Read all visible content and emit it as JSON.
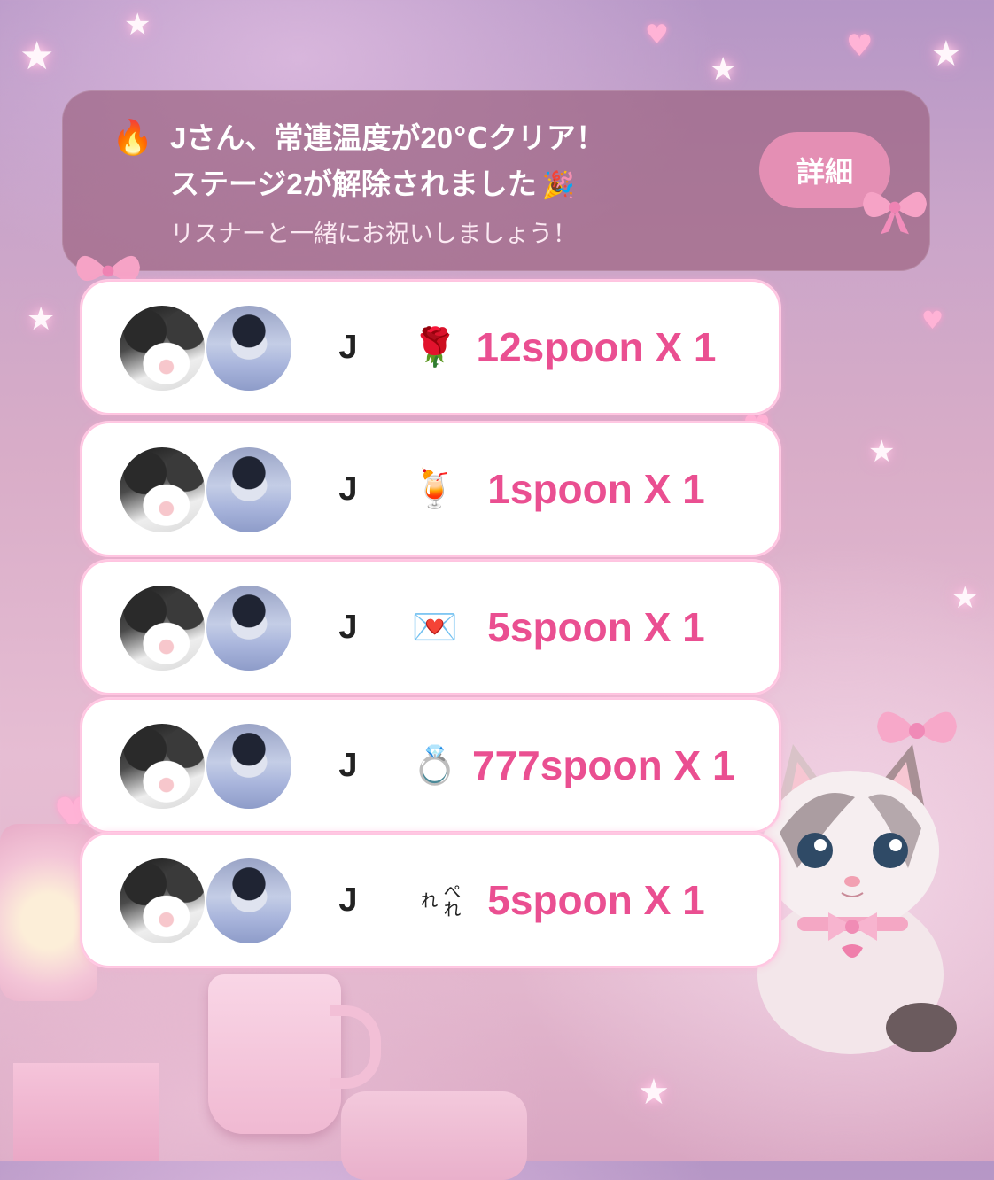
{
  "banner": {
    "icon": "🔥",
    "line1": "Jさん、常連温度が20℃クリア！",
    "line2": "ステージ2が解除されました",
    "line2_icon": "🎉",
    "line3": "リスナーと一緒にお祝いしましょう！",
    "detail_button": "詳細"
  },
  "gifts": [
    {
      "user": "J",
      "gift_icon": "🌹",
      "amount": "12spoon X 1"
    },
    {
      "user": "J",
      "gift_icon": "🍹",
      "amount": "1spoon X 1"
    },
    {
      "user": "J",
      "gift_icon": "💌",
      "amount": "5spoon X 1"
    },
    {
      "user": "J",
      "gift_icon": "💍",
      "amount": "777spoon X 1"
    },
    {
      "user": "J",
      "gift_icon": "ぺれれ",
      "amount": "5spoon X 1"
    }
  ],
  "colors": {
    "accent_pink": "#ea4f91",
    "button_pink": "#e48fb4",
    "banner_bg": "#965a78"
  }
}
